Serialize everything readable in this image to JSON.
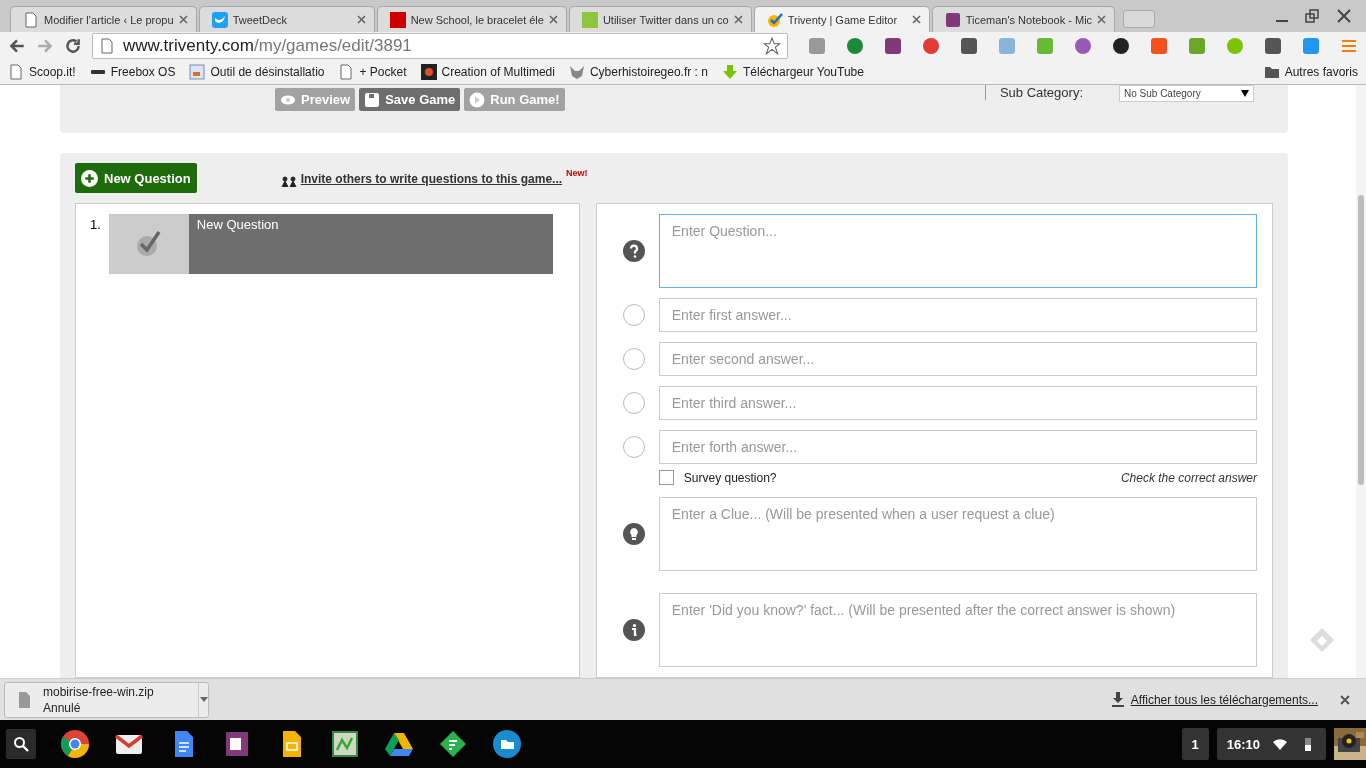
{
  "browser": {
    "tabs": [
      {
        "title": "Modifier l’article ‹ Le propu",
        "selected": false
      },
      {
        "title": "TweetDeck",
        "selected": false
      },
      {
        "title": "New School, le bracelet éle",
        "selected": false
      },
      {
        "title": "Utiliser Twitter dans un co",
        "selected": false
      },
      {
        "title": "Triventy | Game Editor",
        "selected": true
      },
      {
        "title": "Ticeman's Notebook - Mic",
        "selected": false
      }
    ],
    "url": {
      "host": "www.triventy.com",
      "path": "/my/games/edit/3891"
    },
    "bookmarks": [
      {
        "label": "Scoop.it!"
      },
      {
        "label": "Freebox OS"
      },
      {
        "label": "Outil de désinstallatio"
      },
      {
        "label": "+ Pocket"
      },
      {
        "label": "Creation of Multimedi"
      },
      {
        "label": "Cyberhistoiregeo.fr : n"
      },
      {
        "label": "Téléchargeur YouTube"
      }
    ],
    "other_bookmarks": "Autres favoris"
  },
  "toolbar": {
    "buttons": [
      {
        "label": "Preview",
        "disabled": true
      },
      {
        "label": "Save Game",
        "disabled": false
      },
      {
        "label": "Run Game!",
        "disabled": true
      }
    ],
    "sub_category": {
      "label": "Sub Category:",
      "value": "No Sub Category"
    }
  },
  "editor": {
    "new_question": "New Question",
    "invite": {
      "text": "Invite others to write questions to this game...",
      "badge": "New!"
    },
    "questions": [
      {
        "number": "1.",
        "title": "New Question",
        "selected": true
      }
    ],
    "question": {
      "placeholder": "Enter Question..."
    },
    "answers": [
      {
        "placeholder": "Enter first answer...",
        "selected": false
      },
      {
        "placeholder": "Enter second answer...",
        "selected": false
      },
      {
        "placeholder": "Enter third answer...",
        "selected": false
      },
      {
        "placeholder": "Enter forth answer...",
        "selected": false
      }
    ],
    "survey": {
      "label": "Survey question?",
      "checked": false
    },
    "hint": "Check the correct answer",
    "clue": {
      "placeholder": "Enter a Clue... (Will be presented when a user request a clue)"
    },
    "fact": {
      "placeholder": "Enter 'Did you know?' fact... (Will be presented after the correct answer is shown)"
    }
  },
  "download": {
    "file": "mobirise-free-win.zip",
    "status": "Annulé",
    "show_all": "Afficher tous les téléchargements..."
  },
  "shelf": {
    "badge": "1",
    "time": "16:10"
  }
}
